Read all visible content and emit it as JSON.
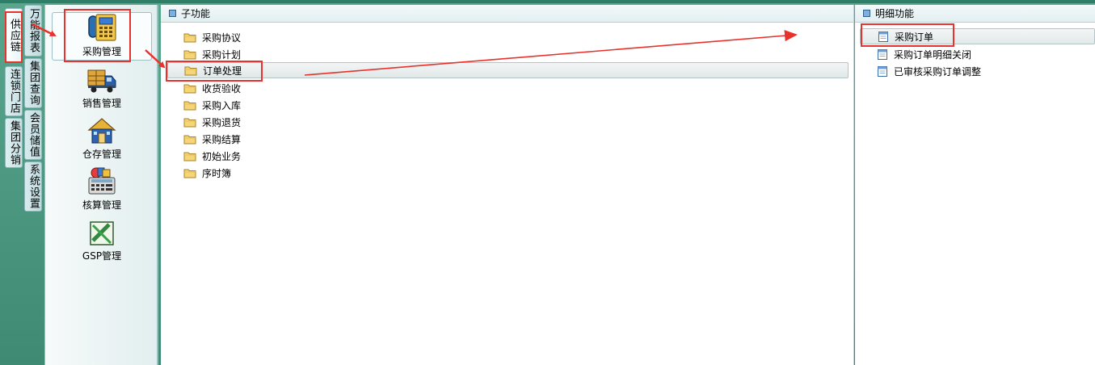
{
  "left_tabs_col1": [
    {
      "label": "供应链",
      "active": true
    },
    {
      "label": "连锁门店",
      "active": false
    },
    {
      "label": "集团分销",
      "active": false
    }
  ],
  "left_tabs_col2": [
    {
      "label": "万能报表"
    },
    {
      "label": "集团查询"
    },
    {
      "label": "会员储值"
    },
    {
      "label": "系统设置"
    }
  ],
  "modules": [
    {
      "label": "采购管理",
      "icon": "purchase-phone-icon",
      "selected": true
    },
    {
      "label": "销售管理",
      "icon": "delivery-truck-icon",
      "selected": false
    },
    {
      "label": "仓存管理",
      "icon": "warehouse-house-icon",
      "selected": false
    },
    {
      "label": "核算管理",
      "icon": "accounting-calculator-icon",
      "selected": false
    },
    {
      "label": "GSP管理",
      "icon": "gsp-certificate-icon",
      "selected": false
    }
  ],
  "sub_panel": {
    "title": "子功能",
    "items": [
      {
        "label": "采购协议",
        "selected": false
      },
      {
        "label": "采购计划",
        "selected": false
      },
      {
        "label": "订单处理",
        "selected": true
      },
      {
        "label": "收货验收",
        "selected": false
      },
      {
        "label": "采购入库",
        "selected": false
      },
      {
        "label": "采购退货",
        "selected": false
      },
      {
        "label": "采购结算",
        "selected": false
      },
      {
        "label": "初始业务",
        "selected": false
      },
      {
        "label": "序时簿",
        "selected": false
      }
    ]
  },
  "detail_panel": {
    "title": "明细功能",
    "items": [
      {
        "label": "采购订单",
        "selected": true
      },
      {
        "label": "采购订单明细关闭",
        "selected": false
      },
      {
        "label": "已审核采购订单调整",
        "selected": false
      }
    ]
  },
  "colors": {
    "annotation_red": "#e8322d",
    "background_teal": "#4a9880",
    "folder_yellow": "#f5d576"
  }
}
